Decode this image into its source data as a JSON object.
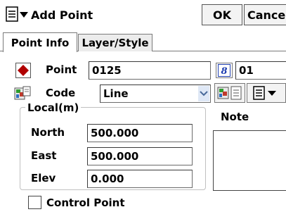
{
  "window": {
    "title": "Add Point",
    "ok_label": "OK",
    "cancel_label": "Cancel"
  },
  "tabs": [
    {
      "label": "Point Info",
      "active": true
    },
    {
      "label": "Layer/Style",
      "active": false
    }
  ],
  "form": {
    "point_label": "Point",
    "point_value": "0125",
    "point_suffix_value": "01",
    "code_label": "Code",
    "code_value": "Line",
    "local_group_label": "Local(m)",
    "north_label": "North",
    "north_value": "500.000",
    "east_label": "East",
    "east_value": "500.000",
    "elev_label": "Elev",
    "elev_value": "0.000",
    "note_label": "Note",
    "note_value": "",
    "control_point_label": "Control Point",
    "control_point_checked": false
  },
  "icons": {
    "menu": "menu-icon",
    "point": "point-marker-icon",
    "code": "code-map-icon",
    "increment": "increment-icon",
    "code_list": "code-list-icon"
  },
  "colors": {
    "point_marker": "#b00000",
    "accent_blue": "#1f3fb0",
    "dropdown_arrow_bg": "#dfe8f6"
  }
}
